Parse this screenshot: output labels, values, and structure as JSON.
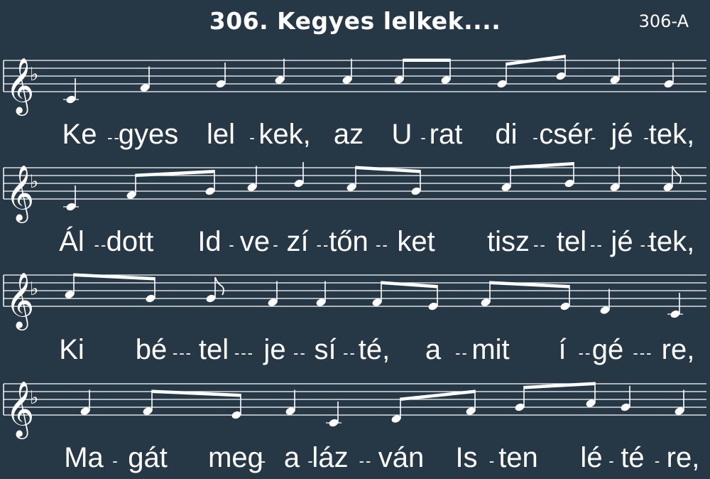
{
  "title": "306. Kegyes lelkek....",
  "code": "306-A",
  "clef": "treble",
  "key_signature": "F major (1 flat)",
  "systems": [
    {
      "notes": [
        {
          "pitch": "C4",
          "dur": "q"
        },
        {
          "pitch": "F4",
          "dur": "q"
        },
        {
          "pitch": "G4",
          "dur": "q"
        },
        {
          "pitch": "A4",
          "dur": "q"
        },
        {
          "pitch": "A4",
          "dur": "q"
        },
        {
          "pitch": "A4",
          "dur": "e"
        },
        {
          "pitch": "A4",
          "dur": "e"
        },
        {
          "pitch": "G4",
          "dur": "e"
        },
        {
          "pitch": "Bb4",
          "dur": "e"
        },
        {
          "pitch": "A4",
          "dur": "q"
        },
        {
          "pitch": "G4",
          "dur": "q"
        }
      ],
      "lyrics": [
        "Ke",
        "gyes",
        "lel",
        "kek,",
        "az",
        "U",
        "rat",
        "di",
        "csér",
        "jé",
        "tek,"
      ],
      "hyphens": [
        "--",
        "",
        "-",
        "",
        "",
        "-",
        "",
        "-",
        "-",
        "-",
        ""
      ]
    },
    {
      "notes": [
        {
          "pitch": "C4",
          "dur": "q"
        },
        {
          "pitch": "F4",
          "dur": "e"
        },
        {
          "pitch": "G4",
          "dur": "e"
        },
        {
          "pitch": "A4",
          "dur": "q"
        },
        {
          "pitch": "Bb4",
          "dur": "q"
        },
        {
          "pitch": "A4",
          "dur": "e"
        },
        {
          "pitch": "G4",
          "dur": "e"
        },
        {
          "pitch": "A4",
          "dur": "e"
        },
        {
          "pitch": "Bb4",
          "dur": "e"
        },
        {
          "pitch": "A4",
          "dur": "q"
        },
        {
          "pitch": "A4",
          "dur": "e"
        }
      ],
      "lyrics": [
        "Ál",
        "dott",
        "Id",
        "ve",
        "zí",
        "tőn",
        "ket",
        "tisz",
        "tel",
        "jé",
        "tek,"
      ],
      "hyphens": [
        "--",
        "",
        "-",
        "-",
        "--",
        "--",
        "",
        "--",
        "--",
        "--",
        ""
      ]
    },
    {
      "notes": [
        {
          "pitch": "A4",
          "dur": "e"
        },
        {
          "pitch": "G4",
          "dur": "e"
        },
        {
          "pitch": "G4",
          "dur": "e"
        },
        {
          "pitch": "F4",
          "dur": "q"
        },
        {
          "pitch": "F4",
          "dur": "q"
        },
        {
          "pitch": "F4",
          "dur": "e"
        },
        {
          "pitch": "E4",
          "dur": "e"
        },
        {
          "pitch": "F4",
          "dur": "e"
        },
        {
          "pitch": "E4",
          "dur": "e"
        },
        {
          "pitch": "D4",
          "dur": "q"
        },
        {
          "pitch": "C4",
          "dur": "q"
        }
      ],
      "lyrics": [
        "Ki",
        "bé",
        "tel",
        "je",
        "sí",
        "té,",
        "a",
        "mit",
        "í",
        "gé",
        "re,"
      ],
      "hyphens": [
        "",
        "---",
        "---",
        "--",
        "--",
        "",
        "--",
        "",
        "--",
        "---",
        ""
      ]
    },
    {
      "notes": [
        {
          "pitch": "F4",
          "dur": "q"
        },
        {
          "pitch": "F4",
          "dur": "e"
        },
        {
          "pitch": "E4",
          "dur": "e"
        },
        {
          "pitch": "F4",
          "dur": "q"
        },
        {
          "pitch": "C4",
          "dur": "q"
        },
        {
          "pitch": "D4",
          "dur": "e"
        },
        {
          "pitch": "F4",
          "dur": "e"
        },
        {
          "pitch": "G4",
          "dur": "e"
        },
        {
          "pitch": "A4",
          "dur": "e"
        },
        {
          "pitch": "G4",
          "dur": "q"
        },
        {
          "pitch": "F4",
          "dur": "q"
        }
      ],
      "lyrics": [
        "Ma",
        "gát",
        "meg",
        "a",
        "láz",
        "ván",
        "Is",
        "ten",
        "lé",
        "té",
        "re,"
      ],
      "hyphens": [
        "-",
        "",
        "-",
        "-",
        "--",
        "",
        "-",
        "",
        "-",
        "-",
        ""
      ]
    }
  ]
}
